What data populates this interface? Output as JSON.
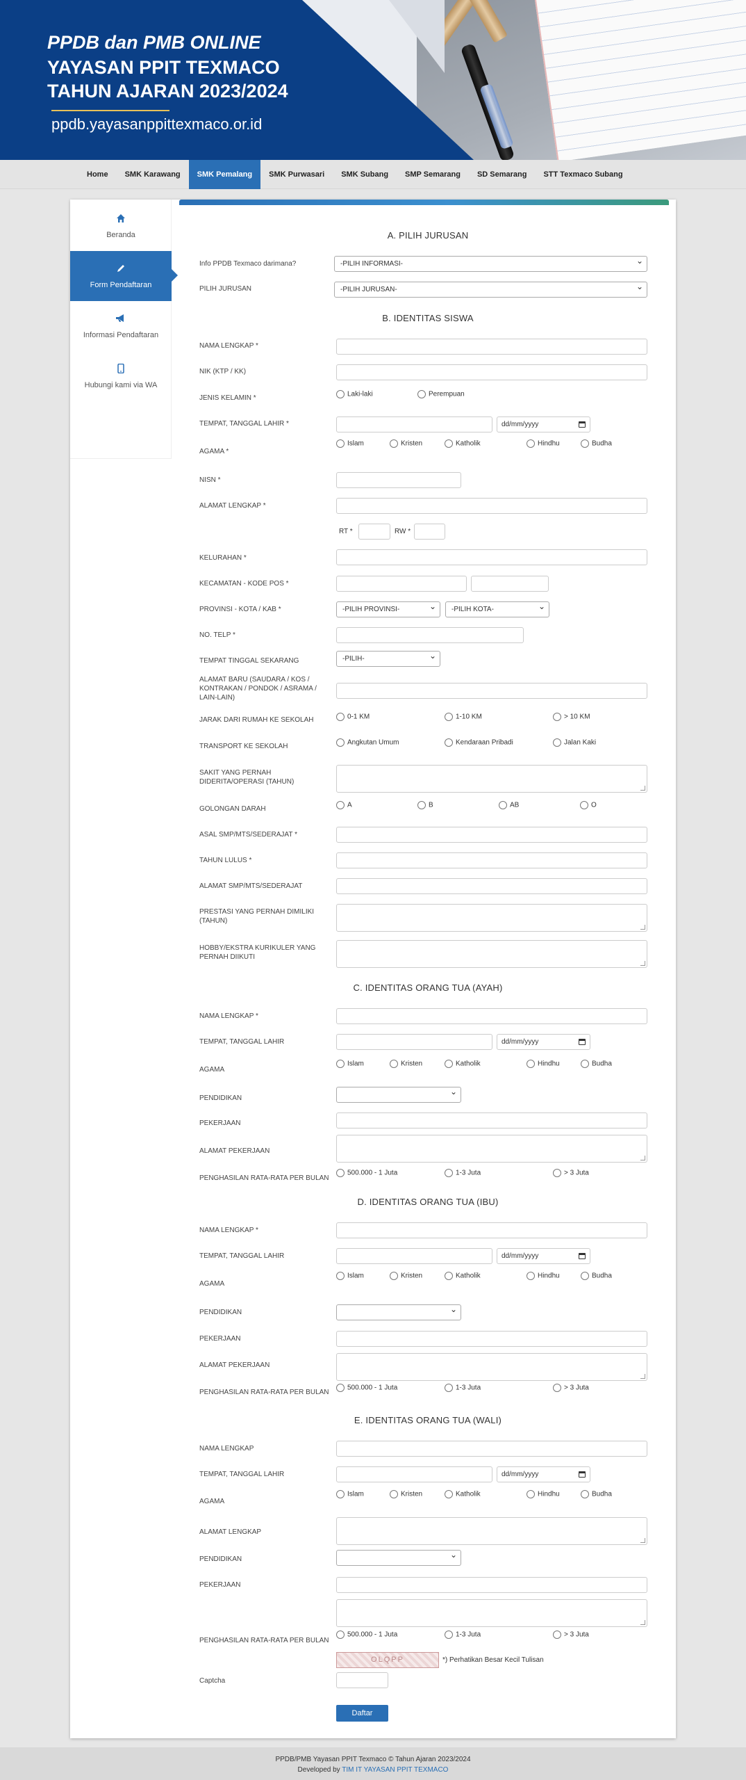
{
  "header": {
    "line1": "PPDB dan PMB ONLINE",
    "line2": "YAYASAN PPIT TEXMACO",
    "line3": "TAHUN AJARAN 2023/2024",
    "url": "ppdb.yayasanppittexmaco.or.id"
  },
  "nav": [
    "Home",
    "SMK Karawang",
    "SMK Pemalang",
    "SMK Purwasari",
    "SMK Subang",
    "SMP Semarang",
    "SD Semarang",
    "STT Texmaco Subang"
  ],
  "sidebar": [
    {
      "label": "Beranda",
      "icon": "home-icon"
    },
    {
      "label": "Form Pendaftaran",
      "icon": "pencil-icon"
    },
    {
      "label": "Informasi Pendaftaran",
      "icon": "megaphone-icon"
    },
    {
      "label": "Hubungi kami via WA",
      "icon": "phone-icon"
    }
  ],
  "sections": {
    "a": "A. PILIH JURUSAN",
    "b": "B. IDENTITAS SISWA",
    "c": "C. IDENTITAS ORANG TUA (AYAH)",
    "d": "D. IDENTITAS ORANG TUA (IBU)",
    "e": "E. IDENTITAS ORANG TUA (WALI)"
  },
  "labels": {
    "info": "Info PPDB Texmaco darimana?",
    "jurusan": "PILIH JURUSAN",
    "nama": "NAMA LENGKAP *",
    "nik": "NIK (KTP / KK)",
    "jk": "JENIS KELAMIN *",
    "ttl_req": "TEMPAT, TANGGAL LAHIR *",
    "agama_req": "AGAMA *",
    "nisn": "NISN *",
    "alamat_req": "ALAMAT LENGKAP *",
    "rt": "RT *",
    "rw": "RW *",
    "kelurahan": "KELURAHAN *",
    "kecamatan": "KECAMATAN - KODE POS *",
    "provinsi": "PROVINSI - KOTA / KAB *",
    "telp": "NO. TELP *",
    "tinggal": "TEMPAT TINGGAL SEKARANG",
    "alamat_baru": "ALAMAT BARU (SAUDARA / KOS / KONTRAKAN / PONDOK / ASRAMA / LAIN-LAIN)",
    "jarak": "JARAK DARI RUMAH KE SEKOLAH",
    "transport": "TRANSPORT KE SEKOLAH",
    "sakit": "SAKIT YANG PERNAH DIDERITA/OPERASI (TAHUN)",
    "goldar": "GOLONGAN DARAH",
    "asal": "ASAL SMP/MTS/SEDERAJAT *",
    "lulus": "TAHUN LULUS *",
    "alamat_smp": "ALAMAT SMP/MTS/SEDERAJAT",
    "prestasi": "PRESTASI YANG PERNAH DIMILIKI (TAHUN)",
    "hobby": "HOBBY/EKSTRA KURIKULER YANG PERNAH DIIKUTI",
    "nama_plain": "NAMA LENGKAP",
    "ttl": "TEMPAT, TANGGAL LAHIR",
    "agama": "AGAMA",
    "pendidikan": "PENDIDIKAN",
    "pekerjaan": "PEKERJAAN",
    "alamat_pekerjaan": "ALAMAT PEKERJAAN",
    "penghasilan": "PENGHASILAN RATA-RATA PER BULAN",
    "alamat_lengkap": "ALAMAT LENGKAP",
    "captcha": "Captcha"
  },
  "selects": {
    "info": "-PILIH INFORMASI-",
    "jurusan": "-PILIH JURUSAN-",
    "provinsi": "-PILIH PROVINSI-",
    "kota": "-PILIH KOTA-",
    "tinggal": "-PILIH-"
  },
  "date_placeholder": "dd/mm/yyyy",
  "options": {
    "jk": [
      "Laki-laki",
      "Perempuan"
    ],
    "agama": [
      "Islam",
      "Kristen",
      "Katholik",
      "Hindhu",
      "Budha"
    ],
    "jarak": [
      "0-1 KM",
      "1-10 KM",
      "> 10 KM"
    ],
    "transport": [
      "Angkutan Umum",
      "Kendaraan Pribadi",
      "Jalan Kaki"
    ],
    "goldar": [
      "A",
      "B",
      "AB",
      "O"
    ],
    "penghasilan": [
      "500.000 - 1 Juta",
      "1-3 Juta",
      "> 3 Juta"
    ]
  },
  "captcha": {
    "image_text": "OLQPP",
    "note": "*) Perhatikan Besar Kecil Tulisan"
  },
  "submit": "Daftar",
  "footer": {
    "line1": "PPDB/PMB Yayasan PPIT Texmaco © Tahun Ajaran 2023/2024",
    "line2_prefix": "Developed by ",
    "line2_link": "TIM IT YAYASAN PPIT TEXMACO"
  }
}
